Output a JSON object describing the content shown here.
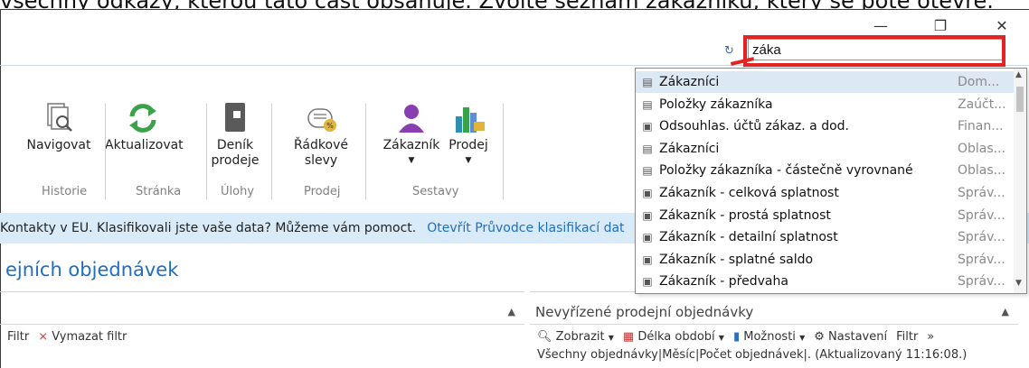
{
  "caption": "všechny odkazy, kterou tato část obsahuje. Zvolte seznam zákazníků, který se poté otevře.",
  "window": {
    "minimize_glyph": "—",
    "restore_glyph": "❐",
    "close_glyph": "✕"
  },
  "search": {
    "value": "záka",
    "refresh_icon": "↻"
  },
  "ribbon": {
    "buttons": [
      {
        "label": "Navigovat"
      },
      {
        "label": "Aktualizovat"
      },
      {
        "label": "Deník\nprodeje"
      },
      {
        "label": "Řádkové\nslevy"
      },
      {
        "label": "Zákazník"
      },
      {
        "label": "Prodej"
      }
    ],
    "groups": [
      "Historie",
      "Stránka",
      "Úlohy",
      "Prodej",
      "Sestavy"
    ]
  },
  "info_bar": {
    "text": "Kontakty v EU. Klasifikovali jste vaše data? Můžeme vám pomoct.",
    "link": "Otevřít Průvodce klasifikací dat"
  },
  "page_title": "ejních objednávek",
  "left_pane": {
    "tools": {
      "filter": "Filtr",
      "clear": "Vymazat filtr"
    }
  },
  "right_pane": {
    "title": "Nevyřízené prodejní objednávky",
    "tools": [
      {
        "label": "Zobrazit"
      },
      {
        "label": "Délka období"
      },
      {
        "label": "Možnosti"
      },
      {
        "label": "Nastavení"
      },
      {
        "label": "Filtr"
      }
    ],
    "info": "Všechny objednávky|Měsíc|Počet objednávek|. (Aktualizovaný 11:16:08.)"
  },
  "dropdown": {
    "items": [
      {
        "name": "Zákazníci",
        "category": "Dom...",
        "icon": "list"
      },
      {
        "name": "Položky zákazníka",
        "category": "Zaúčt...",
        "icon": "list"
      },
      {
        "name": "Odsouhlas. účtů zákaz. a dod.",
        "category": "Finan...",
        "icon": "report"
      },
      {
        "name": "Zákazníci",
        "category": "Oblas...",
        "icon": "list"
      },
      {
        "name": "Položky zákazníka - částečně vyrovnané",
        "category": "Oblas...",
        "icon": "list"
      },
      {
        "name": "Zákazník - celková splatnost",
        "category": "Správ...",
        "icon": "report"
      },
      {
        "name": "Zákazník - prostá splatnost",
        "category": "Správ...",
        "icon": "report"
      },
      {
        "name": "Zákazník - detailní splatnost",
        "category": "Správ...",
        "icon": "report"
      },
      {
        "name": "Zákazník - splatné saldo",
        "category": "Správ...",
        "icon": "report"
      },
      {
        "name": "Zákazník - předvaha",
        "category": "Správ...",
        "icon": "report"
      }
    ]
  },
  "colors": {
    "accent": "#1f6fbf",
    "highlight_red": "#e32224",
    "info_bar_bg": "#d9eaf8",
    "selection_bg": "#dde8f5",
    "purple_icon": "#8a3fb0",
    "green_refresh": "#3aa34a"
  }
}
